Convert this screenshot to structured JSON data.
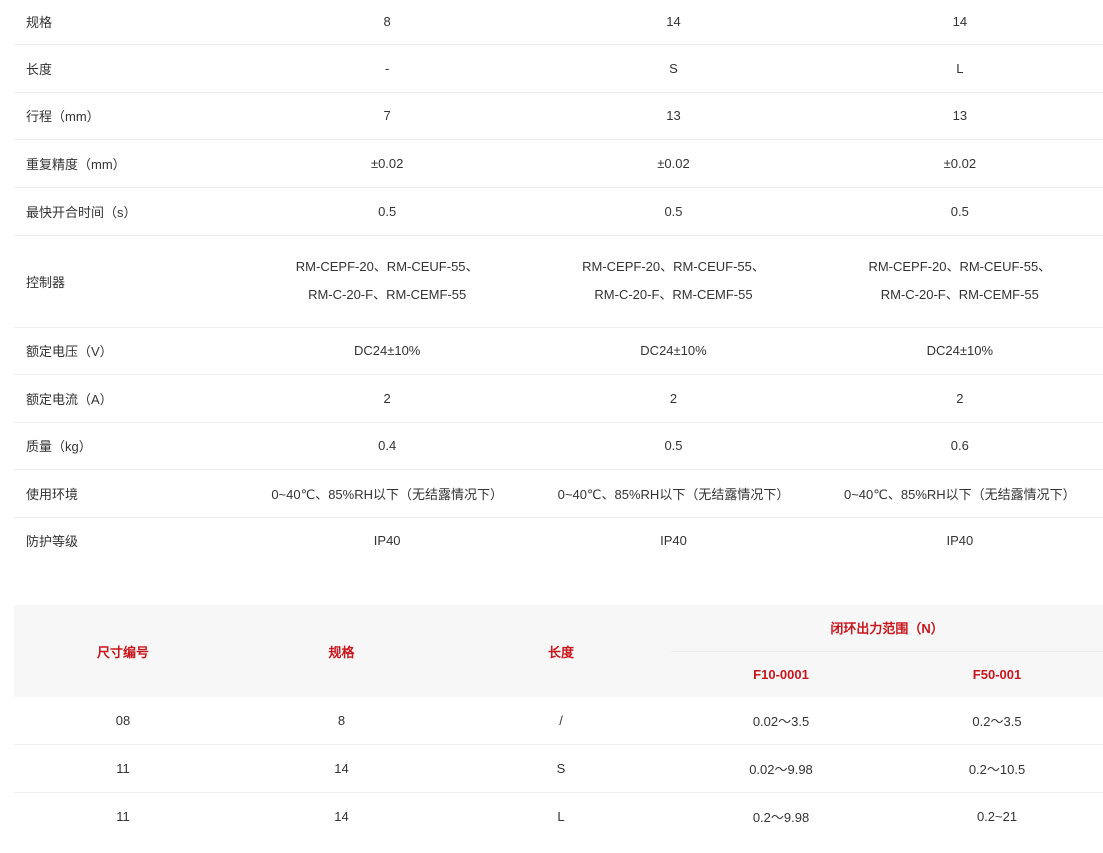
{
  "spec_table": {
    "rows": [
      {
        "label": "规格",
        "values": [
          "8",
          "14",
          "14"
        ]
      },
      {
        "label": "长度",
        "values": [
          "-",
          "S",
          "L"
        ]
      },
      {
        "label": "行程（mm）",
        "values": [
          "7",
          "13",
          "13"
        ]
      },
      {
        "label": "重复精度（mm）",
        "values": [
          "±0.02",
          "±0.02",
          "±0.02"
        ]
      },
      {
        "label": "最快开合时间（s）",
        "values": [
          "0.5",
          "0.5",
          "0.5"
        ]
      },
      {
        "label": "控制器",
        "values": [
          [
            "RM-CEPF-20、RM-CEUF-55、",
            "RM-C-20-F、RM-CEMF-55"
          ],
          [
            "RM-CEPF-20、RM-CEUF-55、",
            "RM-C-20-F、RM-CEMF-55"
          ],
          [
            "RM-CEPF-20、RM-CEUF-55、",
            "RM-C-20-F、RM-CEMF-55"
          ]
        ]
      },
      {
        "label": "额定电压（V）",
        "values": [
          "DC24±10%",
          "DC24±10%",
          "DC24±10%"
        ]
      },
      {
        "label": "额定电流（A）",
        "values": [
          "2",
          "2",
          "2"
        ]
      },
      {
        "label": "质量（kg）",
        "values": [
          "0.4",
          "0.5",
          "0.6"
        ]
      },
      {
        "label": "使用环境",
        "values": [
          "0~40℃、85%RH以下（无结露情况下）",
          "0~40℃、85%RH以下（无结露情况下）",
          "0~40℃、85%RH以下（无结露情况下）"
        ]
      },
      {
        "label": "防护等级",
        "values": [
          "IP40",
          "IP40",
          "IP40"
        ]
      }
    ]
  },
  "size_table": {
    "headers": {
      "size_code": "尺寸编号",
      "spec": "规格",
      "length": "长度",
      "force_group": "闭环出力范围（N）",
      "col_a": "F10-0001",
      "col_b": "F50-001"
    },
    "rows": [
      [
        "08",
        "8",
        "/",
        "0.02～3.5",
        "0.2～3.5"
      ],
      [
        "11",
        "14",
        "S",
        "0.02～9.98",
        "0.2～10.5"
      ],
      [
        "11",
        "14",
        "L",
        "0.2～9.98",
        "0.2~21"
      ]
    ]
  },
  "colors": {
    "header_text": "#c8161d",
    "header_bg": "#f7f7f7",
    "row_border": "#eeeeee",
    "text": "#333333"
  }
}
